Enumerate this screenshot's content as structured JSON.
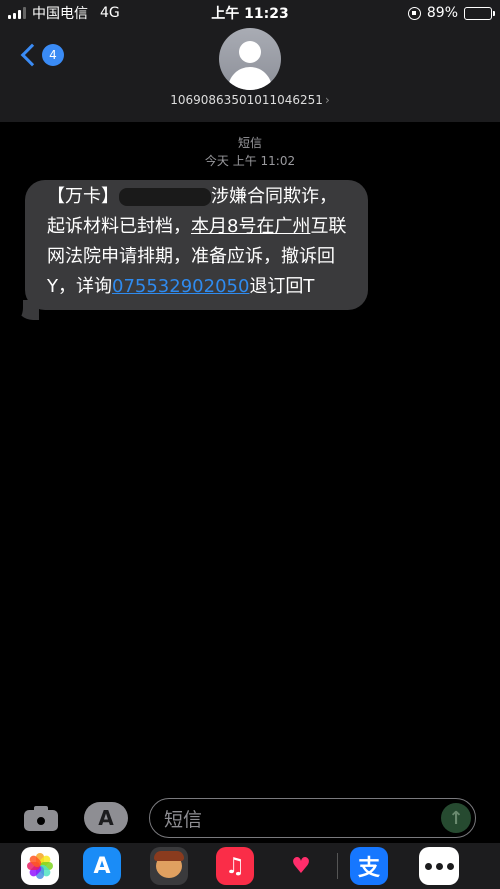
{
  "status_bar": {
    "carrier": "中国电信",
    "network": "4G",
    "time": "上午 11:23",
    "battery_percent": "89%",
    "battery_level": 0.89
  },
  "header": {
    "back_badge": "4",
    "contact_number": "106908635010110462​51",
    "contact_arrow": "›"
  },
  "conversation": {
    "label": "短信",
    "timestamp": "今天 上午 11:02",
    "message": {
      "seg1": "【万卡】",
      "seg2": "涉嫌合同欺诈，起诉材料已封档，",
      "seg3": "本月8号在广州",
      "seg4": "互联网法院申请排期，准备应诉，撤诉回Y，详询",
      "phone": "075532902050",
      "seg5": "退订回T"
    }
  },
  "input": {
    "placeholder": "短信",
    "apps_glyph": "A",
    "send_glyph": "↑"
  },
  "app_strip": {
    "app_store_glyph": "A",
    "music_glyph": "♫",
    "heart_glyph": "♥",
    "alipay_glyph": "支"
  },
  "colors": {
    "accent": "#3a8bf5",
    "bubble": "#3a3a3c",
    "link": "#2f8bef"
  }
}
